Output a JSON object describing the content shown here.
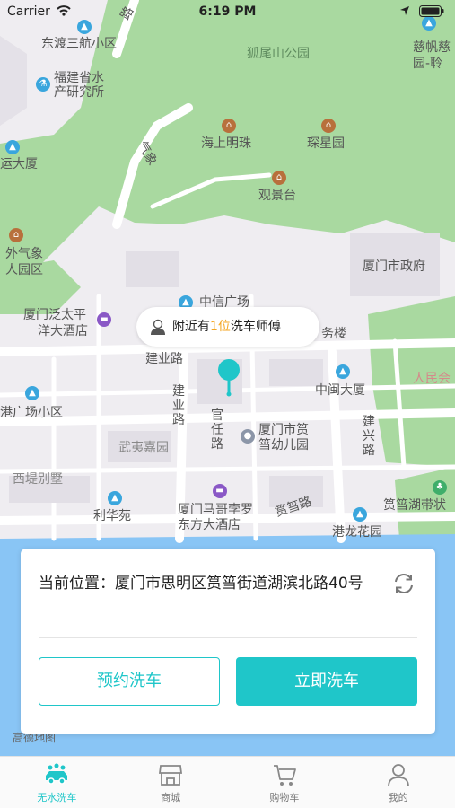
{
  "status_bar": {
    "carrier": "Carrier",
    "time": "6:19 PM"
  },
  "map": {
    "labels": {
      "dongdu": "东渡三航小区",
      "fujian1": "福建省水",
      "fujian2": "产研究所",
      "yun": "运大厦",
      "huwei": "狐尾山公园",
      "cifan1": "慈帆慈",
      "cifan2": "园-聆",
      "haishang": "海上明珠",
      "chenxing": "琛星园",
      "guanjing": "观景台",
      "qixiang": "气象",
      "road_up": "路",
      "waiqi1": "外气象",
      "waiqi2": "人园区",
      "zhengfu": "厦门市政府",
      "zhongxin": "中信广场",
      "fantai1": "厦门泛太平",
      "fantai2": "洋大酒店",
      "wulou": "务楼",
      "jianye": "建业路",
      "renmin": "人民会",
      "zhongmin": "中闽大厦",
      "jianye_v": "建业路",
      "guanren": "官任路",
      "youer1": "厦门市筼",
      "youer2": "筜幼儿园",
      "jianxing": "建兴路",
      "gangchang": "港广场小区",
      "wuyi": "武夷嘉园",
      "xidi": "西堤别墅",
      "lihua": "利华苑",
      "mage1": "厦门马哥孛罗",
      "mage2": "东方大酒店",
      "yundang": "筼筜路",
      "hudai": "筼筜湖带状",
      "ganglong": "港龙花园",
      "gaode": "高德地图"
    }
  },
  "bubble": {
    "prefix": "附近有",
    "count": "1位",
    "suffix": "洗车师傅"
  },
  "card": {
    "location": "当前位置：厦门市思明区筼筜街道湖滨北路40号",
    "reserve_button": "预约洗车",
    "now_button": "立即洗车"
  },
  "tabs": [
    {
      "label": "无水洗车",
      "icon": "car-wash-icon",
      "active": true
    },
    {
      "label": "商城",
      "icon": "store-icon",
      "active": false
    },
    {
      "label": "购物车",
      "icon": "cart-icon",
      "active": false
    },
    {
      "label": "我的",
      "icon": "profile-icon",
      "active": false
    }
  ],
  "colors": {
    "accent": "#1fc6c9",
    "highlight": "#f4a623",
    "park": "#a9d9a0",
    "water": "#89c5f5"
  }
}
